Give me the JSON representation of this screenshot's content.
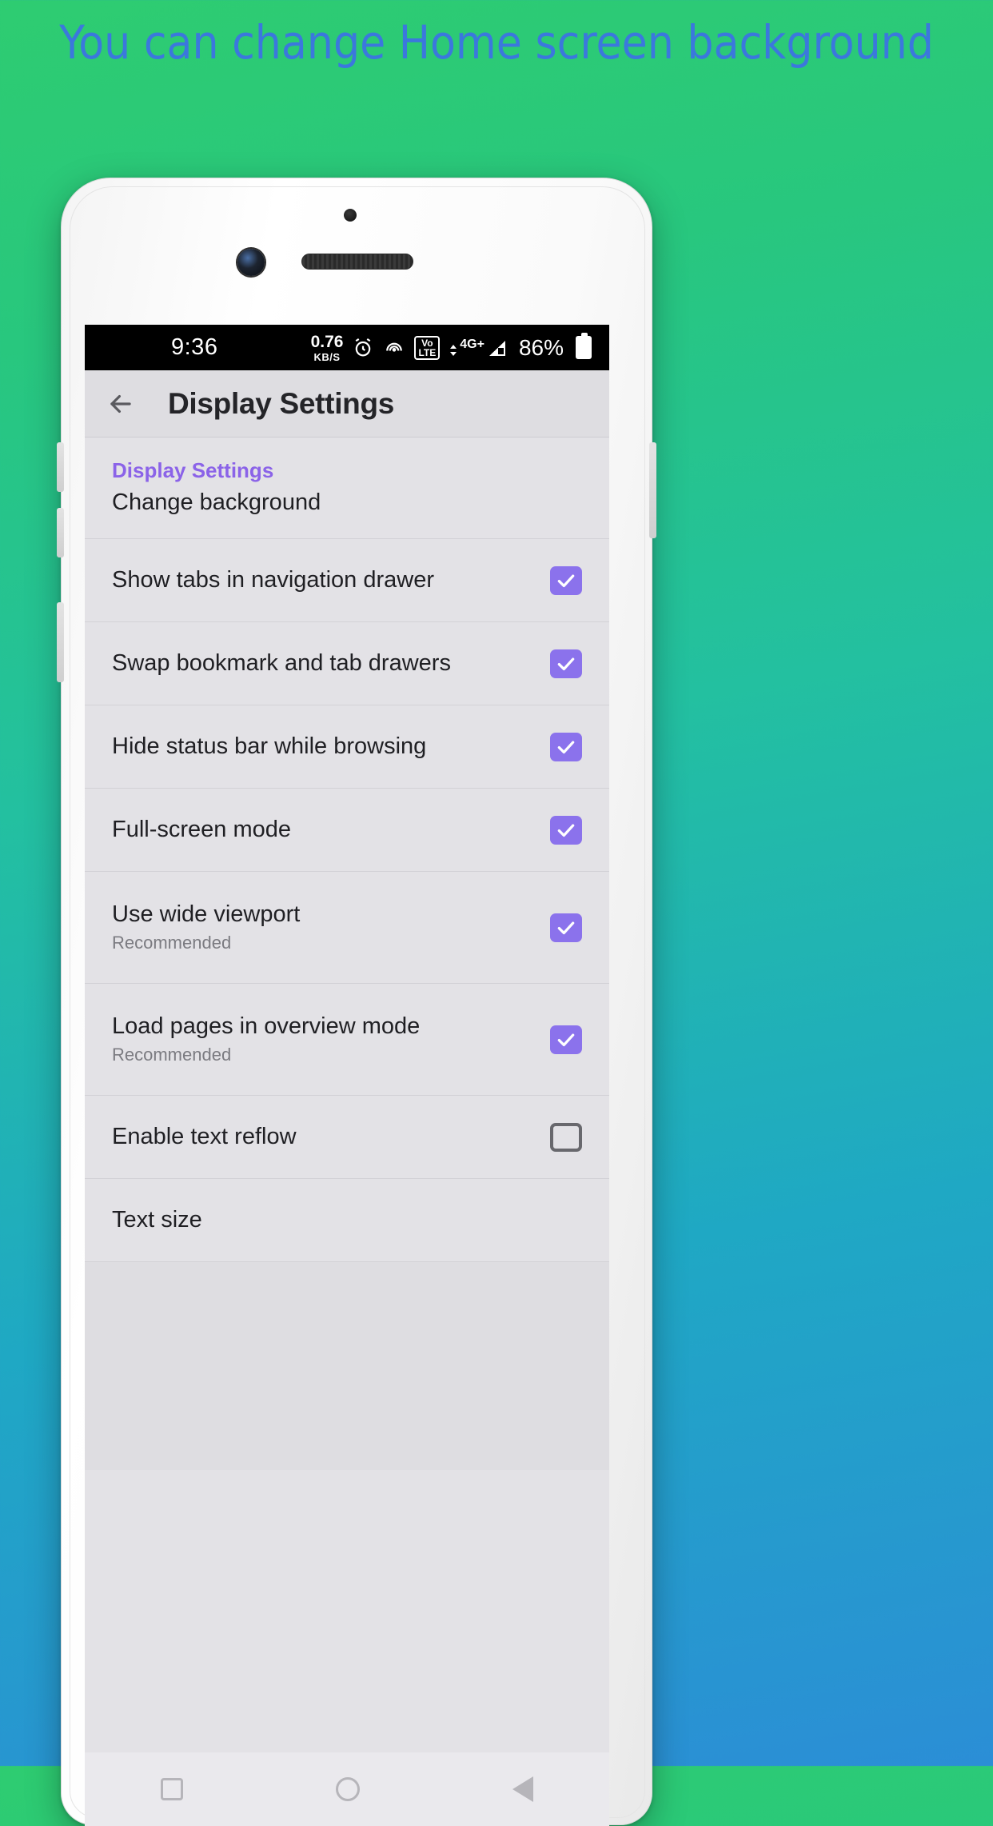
{
  "promo": {
    "headline": "You can change Home screen background",
    "headline_color": "#3b78dd"
  },
  "status_bar": {
    "time": "9:36",
    "network_speed_value": "0.76",
    "network_speed_unit": "KB/S",
    "alarm_icon": "alarm-clock-icon",
    "hotspot_icon": "nearby-share-icon",
    "volte_top": "Vo",
    "volte_bottom": "LTE",
    "signal_label": "4G+",
    "battery_percent": "86%",
    "battery_icon": "battery-full-icon"
  },
  "app_bar": {
    "back_icon": "back-arrow-icon",
    "title": "Display Settings"
  },
  "settings": {
    "section_header": "Display Settings",
    "items": [
      {
        "title": "Change background",
        "subtitle": "",
        "control": "none",
        "checked": false
      },
      {
        "title": "Show tabs in navigation drawer",
        "subtitle": "",
        "control": "checkbox",
        "checked": true
      },
      {
        "title": "Swap bookmark and tab drawers",
        "subtitle": "",
        "control": "checkbox",
        "checked": true
      },
      {
        "title": "Hide status bar while browsing",
        "subtitle": "",
        "control": "checkbox",
        "checked": true
      },
      {
        "title": "Full-screen mode",
        "subtitle": "",
        "control": "checkbox",
        "checked": true
      },
      {
        "title": "Use wide viewport",
        "subtitle": "Recommended",
        "control": "checkbox",
        "checked": true
      },
      {
        "title": "Load pages in overview mode",
        "subtitle": "Recommended",
        "control": "checkbox",
        "checked": true
      },
      {
        "title": "Enable text reflow",
        "subtitle": "",
        "control": "checkbox",
        "checked": false
      },
      {
        "title": "Text size",
        "subtitle": "",
        "control": "none",
        "checked": false
      }
    ],
    "accent_color": "#8b72ec",
    "header_color": "#8b63e8"
  },
  "nav_bar": {
    "recents_icon": "recents-square-icon",
    "home_icon": "home-circle-icon",
    "back_icon": "back-triangle-icon"
  }
}
